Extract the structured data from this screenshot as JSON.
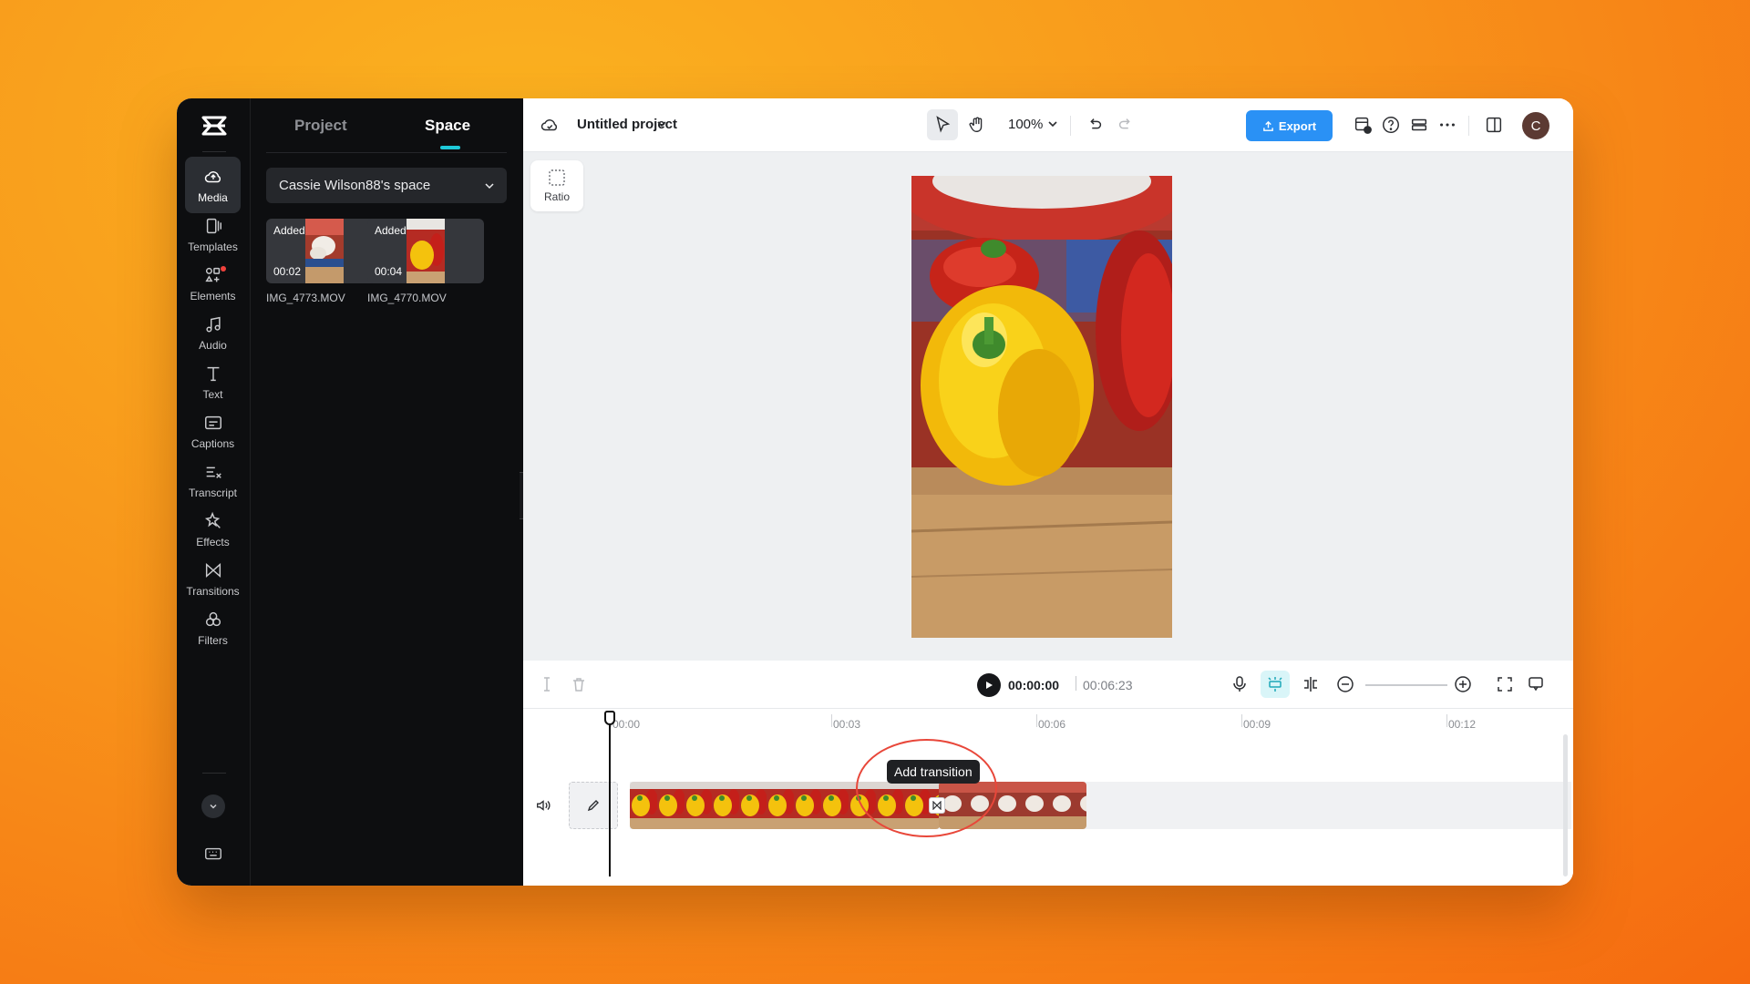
{
  "rail": {
    "items": [
      {
        "label": "Media",
        "icon": "media-cloud-icon"
      },
      {
        "label": "Templates",
        "icon": "templates-icon"
      },
      {
        "label": "Elements",
        "icon": "elements-icon"
      },
      {
        "label": "Audio",
        "icon": "audio-note-icon"
      },
      {
        "label": "Text",
        "icon": "text-icon"
      },
      {
        "label": "Captions",
        "icon": "captions-icon"
      },
      {
        "label": "Transcript",
        "icon": "transcript-icon"
      },
      {
        "label": "Effects",
        "icon": "effects-icon"
      },
      {
        "label": "Transitions",
        "icon": "transitions-icon"
      },
      {
        "label": "Filters",
        "icon": "filters-icon"
      }
    ]
  },
  "panel": {
    "tabs": [
      {
        "label": "Project"
      },
      {
        "label": "Space"
      }
    ],
    "space_select": "Cassie Wilson88's space",
    "media": [
      {
        "name": "IMG_4773.MOV",
        "badge": "Added",
        "duration": "00:02"
      },
      {
        "name": "IMG_4770.MOV",
        "badge": "Added",
        "duration": "00:04"
      }
    ]
  },
  "topbar": {
    "project_title": "Untitled project",
    "zoom": "100%",
    "export_label": "Export",
    "avatar_initial": "C"
  },
  "canvas": {
    "ratio_label": "Ratio"
  },
  "playback": {
    "current_time": "00:00:00",
    "total_time": "00:06:23"
  },
  "timeline": {
    "ticks": [
      "00:00",
      "00:03",
      "00:06",
      "00:09",
      "00:12"
    ],
    "tooltip": "Add transition"
  },
  "colors": {
    "accent": "#2a91f5",
    "tab_underline": "#1ec9d8",
    "highlight": "#e8473a",
    "dark_panel": "#0d0e10"
  }
}
